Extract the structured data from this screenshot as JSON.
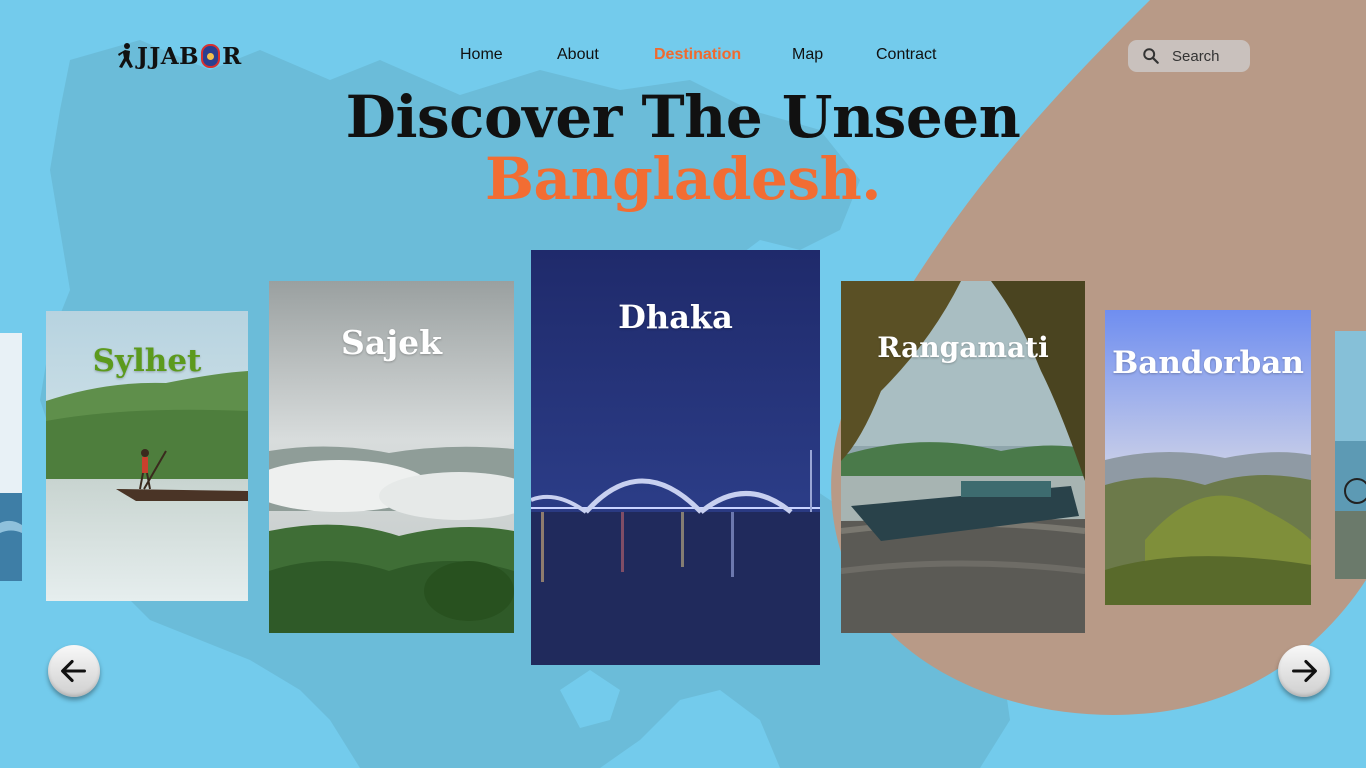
{
  "brand": {
    "logo_left": "J",
    "logo_mid": "JAB",
    "logo_right": "R"
  },
  "nav": {
    "items": [
      {
        "label": "Home",
        "active": false
      },
      {
        "label": "About",
        "active": false
      },
      {
        "label": "Destination",
        "active": true
      },
      {
        "label": "Map",
        "active": false
      },
      {
        "label": "Contract",
        "active": false
      }
    ]
  },
  "search": {
    "placeholder": "Search",
    "icon": "search-icon"
  },
  "hero": {
    "line1": "Discover The Unseen",
    "line2": "Bangladesh."
  },
  "destinations": [
    {
      "name": "Sylhet",
      "title_color": "#5c9a1d"
    },
    {
      "name": "Sajek",
      "title_color": "#ffffff"
    },
    {
      "name": "Dhaka",
      "title_color": "#ffffff"
    },
    {
      "name": "Rangamati",
      "title_color": "#ffffff"
    },
    {
      "name": "Bandorban",
      "title_color": "#ffffff"
    }
  ],
  "controls": {
    "prev_icon": "arrow-left-icon",
    "next_icon": "arrow-right-icon"
  },
  "colors": {
    "background": "#73cbec",
    "blob": "#b89a87",
    "accent": "#ef6a2f",
    "text": "#111111"
  }
}
